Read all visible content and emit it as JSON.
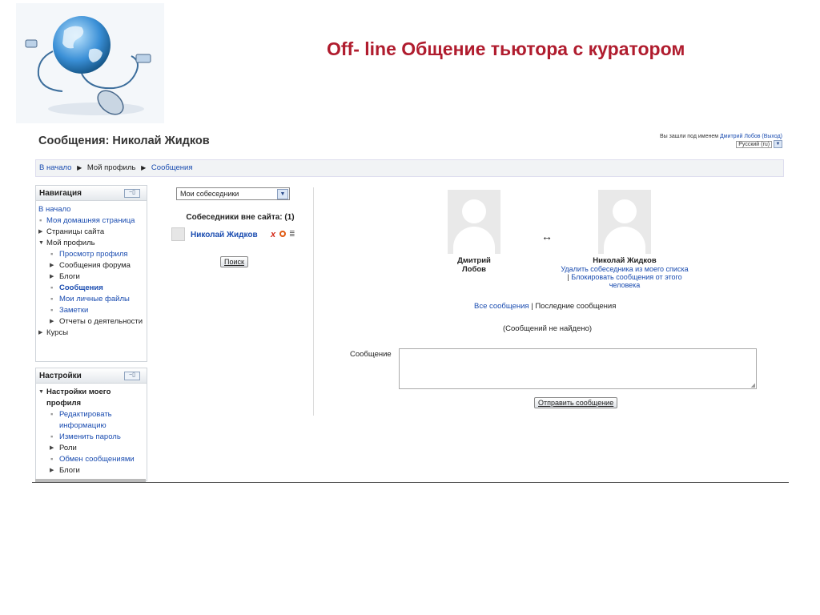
{
  "slide": {
    "title": "Off- line Общение тьютора с куратором"
  },
  "page": {
    "heading": "Сообщения: Николай Жидков",
    "login": {
      "prefix": "Вы зашли под именем",
      "user": "Дмитрий Лобов",
      "logout": "(Выход)",
      "language": "Русский (ru)"
    },
    "breadcrumb": [
      "В начало",
      "Мой профиль",
      "Сообщения"
    ]
  },
  "nav_block": {
    "title": "Навигация",
    "items": [
      "В начало",
      "Моя домашняя страница",
      "Страницы сайта",
      "Мой профиль",
      "Просмотр профиля",
      "Сообщения форума",
      "Блоги",
      "Сообщения",
      "Мои личные файлы",
      "Заметки",
      "Отчеты о деятельности",
      "Курсы"
    ]
  },
  "settings_block": {
    "title": "Настройки",
    "items": [
      "Настройки моего профиля",
      "Редактировать информацию",
      "Изменить пароль",
      "Роли",
      "Обмен сообщениями",
      "Блоги"
    ]
  },
  "contacts": {
    "select_value": "Мои собеседники",
    "offline_heading": "Собеседники вне сайта: (1)",
    "list": [
      {
        "name": "Николай Жидков"
      }
    ],
    "search_button": "Поиск"
  },
  "conversation": {
    "me": {
      "name": "Дмитрий Лобов"
    },
    "other": {
      "name": "Николай Жидков",
      "remove_link": "Удалить собеседника из моего списка",
      "separator": "|",
      "block_link": "Блокировать сообщения от этого человека"
    },
    "arrow": "↔",
    "all_messages": "Все сообщения",
    "separator": " | ",
    "recent_messages": "Последние сообщения",
    "not_found": "(Сообщений не найдено)",
    "message_label": "Сообщение",
    "send_button": "Отправить сообщение"
  }
}
